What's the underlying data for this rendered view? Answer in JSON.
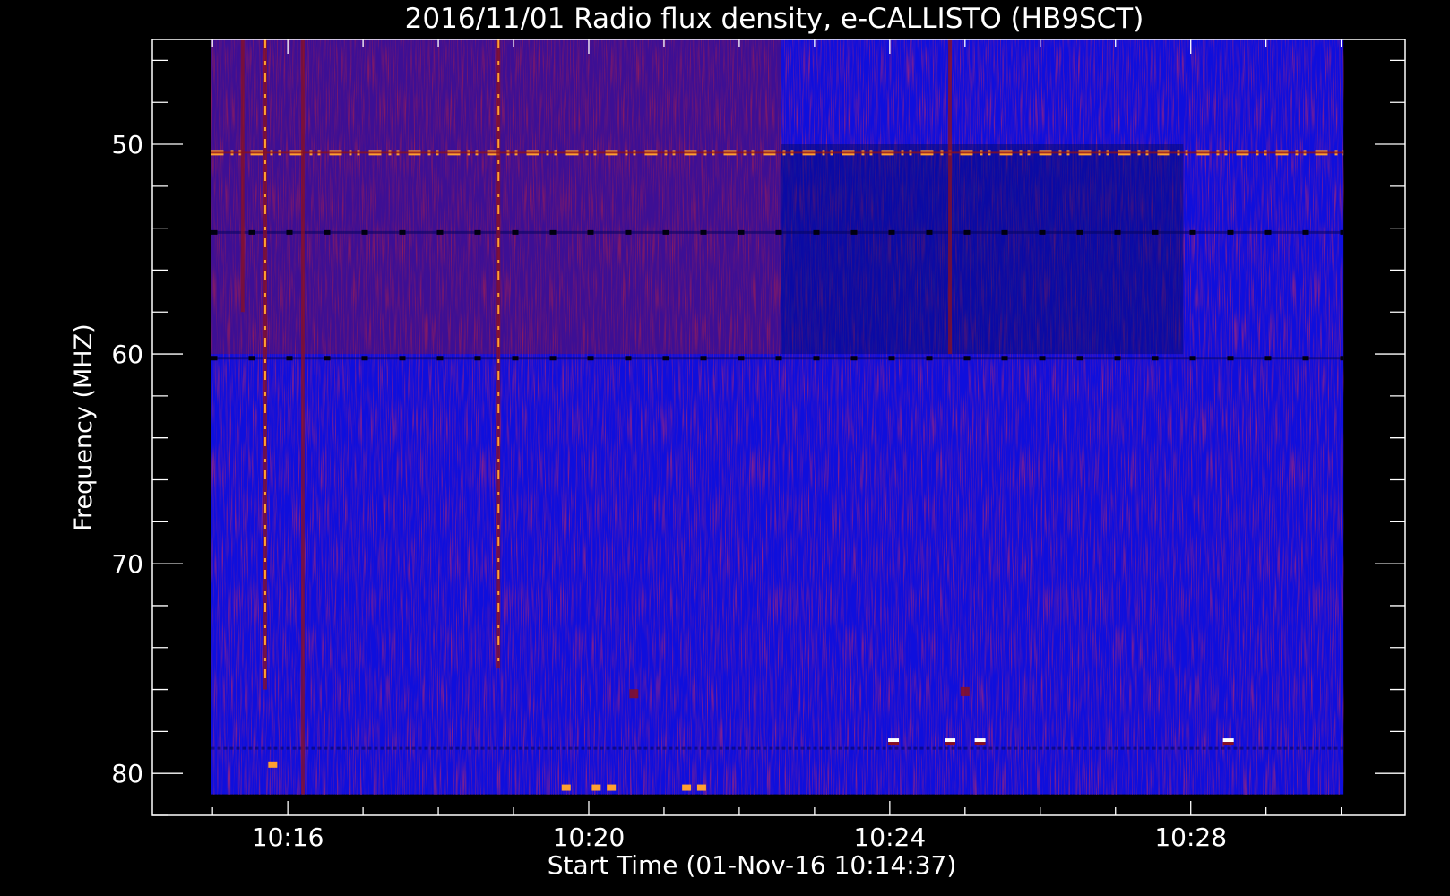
{
  "chart_data": {
    "type": "heatmap",
    "title": "2016/11/01  Radio flux density, e-CALLISTO (HB9SCT)",
    "xlabel": "Start Time (01-Nov-16 10:14:37)",
    "ylabel": "Frequency (MHZ)",
    "x_tick_labels": [
      "10:16",
      "10:20",
      "10:24",
      "10:28"
    ],
    "y_tick_labels": [
      "50",
      "60",
      "70",
      "80"
    ],
    "x_tick_values_min": [
      16,
      20,
      24,
      28
    ],
    "y_tick_values": [
      50,
      60,
      70,
      80
    ],
    "x_range_min": [
      14.2,
      30.85
    ],
    "data_x_range_min": [
      14.98,
      30.03
    ],
    "y_range_mhz": [
      45,
      82
    ],
    "data_y_range_mhz": [
      45,
      81
    ],
    "y_axis_inverted": true,
    "colormap": "blue-red-yellow (intensity)",
    "colors": {
      "background": "#0f0fdc",
      "low": "#050560",
      "mid": "#8a1020",
      "high": "#ffa030",
      "peak": "#ffffff",
      "axis": "#ffffff",
      "figure_bg": "#000000"
    },
    "background_level": "uniform blue",
    "features": {
      "horizontal_interference_lines": [
        {
          "freq_mhz": 50.4,
          "t_start_min": 14.98,
          "t_end_min": 30.03,
          "kind": "bright dashed"
        },
        {
          "freq_mhz": 54.2,
          "t_start_min": 14.98,
          "t_end_min": 30.03,
          "kind": "dark dashed"
        },
        {
          "freq_mhz": 60.2,
          "t_start_min": 14.98,
          "t_end_min": 30.03,
          "kind": "dark dashed"
        },
        {
          "freq_mhz": 78.8,
          "t_start_min": 14.98,
          "t_end_min": 30.03,
          "kind": "faint"
        }
      ],
      "vertical_bursts": [
        {
          "t_min": 15.4,
          "f_start_mhz": 45,
          "f_end_mhz": 58,
          "intensity": "mid"
        },
        {
          "t_min": 15.7,
          "f_start_mhz": 45,
          "f_end_mhz": 76,
          "intensity": "high"
        },
        {
          "t_min": 16.2,
          "f_start_mhz": 45,
          "f_end_mhz": 81,
          "intensity": "mid"
        },
        {
          "t_min": 18.8,
          "f_start_mhz": 45,
          "f_end_mhz": 75,
          "intensity": "high"
        },
        {
          "t_min": 24.8,
          "f_start_mhz": 45,
          "f_end_mhz": 60,
          "intensity": "mid"
        }
      ],
      "enhanced_region": {
        "t_start_min": 14.98,
        "t_end_min": 22.55,
        "f_start_mhz": 45,
        "f_end_mhz": 60,
        "level": "elevated (reddish)"
      },
      "depressed_region": {
        "t_start_min": 22.55,
        "t_end_min": 27.9,
        "f_start_mhz": 50,
        "f_end_mhz": 60,
        "level": "low (dark)"
      },
      "spots": [
        {
          "t_min": 19.7,
          "f_mhz": 80.7,
          "level": "high"
        },
        {
          "t_min": 20.1,
          "f_mhz": 80.7,
          "level": "high"
        },
        {
          "t_min": 20.3,
          "f_mhz": 80.7,
          "level": "high"
        },
        {
          "t_min": 21.3,
          "f_mhz": 80.7,
          "level": "high"
        },
        {
          "t_min": 21.5,
          "f_mhz": 80.7,
          "level": "high"
        },
        {
          "t_min": 24.05,
          "f_mhz": 78.5,
          "level": "peak"
        },
        {
          "t_min": 24.8,
          "f_mhz": 78.5,
          "level": "peak"
        },
        {
          "t_min": 25.2,
          "f_mhz": 78.5,
          "level": "peak"
        },
        {
          "t_min": 28.5,
          "f_mhz": 78.5,
          "level": "peak"
        },
        {
          "t_min": 15.8,
          "f_mhz": 79.6,
          "level": "high"
        },
        {
          "t_min": 20.6,
          "f_mhz": 76.2,
          "level": "mid"
        },
        {
          "t_min": 25.0,
          "f_mhz": 76.1,
          "level": "mid"
        }
      ]
    }
  }
}
